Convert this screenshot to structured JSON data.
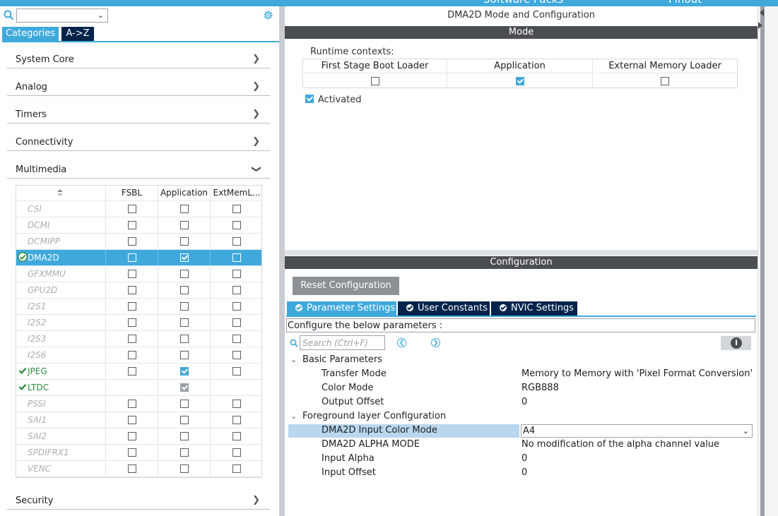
{
  "topbar": {
    "left_text": "Software Packs",
    "right_text": "Pinout"
  },
  "left": {
    "tabs": {
      "categories": "Categories",
      "az": "A->Z"
    },
    "categories": [
      {
        "label": "System Core"
      },
      {
        "label": "Analog"
      },
      {
        "label": "Timers"
      },
      {
        "label": "Connectivity"
      },
      {
        "label": "Multimedia"
      }
    ],
    "security": "Security",
    "grid": {
      "headers": {
        "fsbl": "FSBL",
        "application": "Application",
        "extmem": "ExtMemL..."
      },
      "rows": [
        {
          "name": "CSI",
          "state": "off",
          "fsbl": "box",
          "app": "box",
          "ext": "box"
        },
        {
          "name": "DCMI",
          "state": "off",
          "fsbl": "box",
          "app": "box",
          "ext": "box"
        },
        {
          "name": "DCMIPP",
          "state": "off",
          "fsbl": "box",
          "app": "box",
          "ext": "box"
        },
        {
          "name": "DMA2D",
          "state": "selected",
          "fsbl": "box",
          "app": "checked",
          "ext": "box"
        },
        {
          "name": "GFXMMU",
          "state": "off",
          "fsbl": "box",
          "app": "box",
          "ext": "box"
        },
        {
          "name": "GPU2D",
          "state": "off",
          "fsbl": "box",
          "app": "box",
          "ext": "box"
        },
        {
          "name": "I2S1",
          "state": "off",
          "fsbl": "box",
          "app": "box",
          "ext": "box"
        },
        {
          "name": "I2S2",
          "state": "off",
          "fsbl": "box",
          "app": "box",
          "ext": "box"
        },
        {
          "name": "I2S3",
          "state": "off",
          "fsbl": "box",
          "app": "box",
          "ext": "box"
        },
        {
          "name": "I2S6",
          "state": "off",
          "fsbl": "box",
          "app": "box",
          "ext": "box"
        },
        {
          "name": "JPEG",
          "state": "on",
          "fsbl": "box",
          "app": "checked",
          "ext": "box"
        },
        {
          "name": "LTDC",
          "state": "on",
          "fsbl": "none",
          "app": "disabled",
          "ext": "none"
        },
        {
          "name": "PSSI",
          "state": "off",
          "fsbl": "box",
          "app": "box",
          "ext": "box"
        },
        {
          "name": "SAI1",
          "state": "off",
          "fsbl": "box",
          "app": "box",
          "ext": "box"
        },
        {
          "name": "SAI2",
          "state": "off",
          "fsbl": "box",
          "app": "box",
          "ext": "box"
        },
        {
          "name": "SPDIFRX1",
          "state": "off",
          "fsbl": "box",
          "app": "box",
          "ext": "box"
        },
        {
          "name": "VENC",
          "state": "off",
          "fsbl": "box",
          "app": "box",
          "ext": "box"
        }
      ]
    }
  },
  "right": {
    "title": "DMA2D Mode and Configuration",
    "mode_header": "Mode",
    "runtime_label": "Runtime contexts:",
    "runtime_cols": [
      "First Stage Boot Loader",
      "Application",
      "External Memory Loader"
    ],
    "runtime_checked": [
      false,
      true,
      false
    ],
    "activated": "Activated",
    "config_header": "Configuration",
    "reset_button": "Reset Configuration",
    "param_tabs": [
      "Parameter Settings",
      "User Constants",
      "NVIC Settings"
    ],
    "configure_text": "Configure the below parameters :",
    "search_placeholder": "Search (Ctrl+F)",
    "groups": {
      "basic": "Basic Parameters",
      "foreground": "Foreground layer Configuration"
    },
    "params": {
      "transfer_mode": {
        "k": "Transfer Mode",
        "v": "Memory to Memory with 'Pixel Format Conversion'"
      },
      "color_mode": {
        "k": "Color Mode",
        "v": "RGB888"
      },
      "output_offset": {
        "k": "Output Offset",
        "v": "0"
      },
      "input_color_mode": {
        "k": "DMA2D Input Color Mode",
        "v": "A4"
      },
      "alpha_mode": {
        "k": "DMA2D ALPHA MODE",
        "v": "No modification of the alpha channel value"
      },
      "input_alpha": {
        "k": "Input Alpha",
        "v": "0"
      },
      "input_offset": {
        "k": "Input Offset",
        "v": "0"
      }
    }
  },
  "colors": {
    "accent": "#3fa9dc",
    "navy": "#03234b",
    "header_dark": "#4a4e52",
    "ok_green": "#2e8b3d"
  }
}
